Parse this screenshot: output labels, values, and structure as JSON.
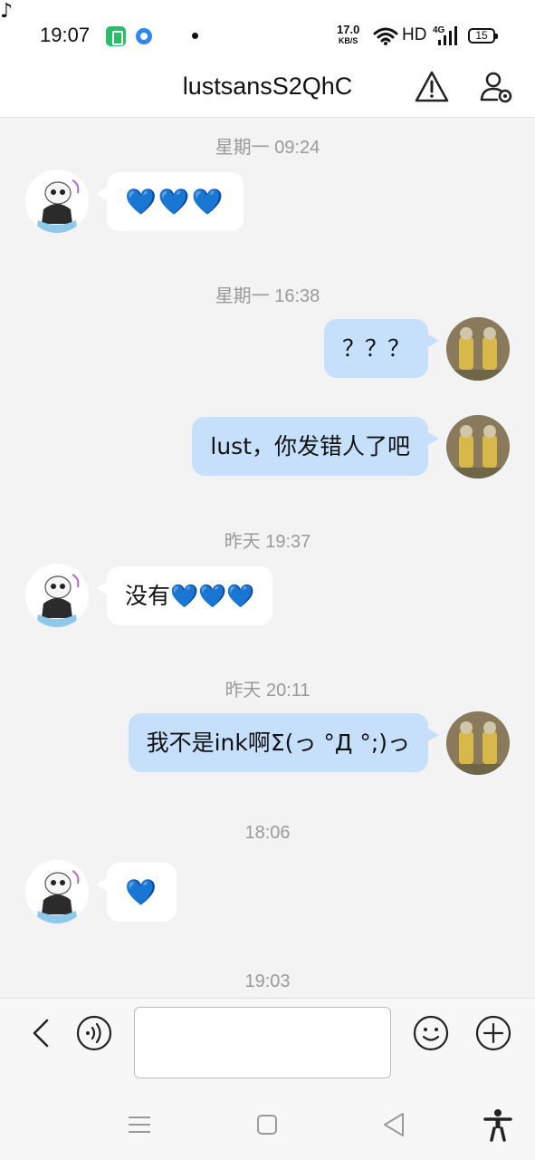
{
  "status_bar": {
    "time": "19:07",
    "net_speed": "17.0",
    "net_speed_unit": "KB/S",
    "hd": "HD",
    "network": "4G",
    "battery": "15",
    "icons": [
      "battery-saver-icon",
      "browser-icon",
      "tiktok-icon",
      "dot-icon",
      "wifi-icon",
      "signal-icon"
    ]
  },
  "header": {
    "title": "lustsansS2QhC",
    "icons": [
      "warning-icon",
      "user-settings-icon"
    ]
  },
  "messages": [
    {
      "timestamp": "星期一 09:24"
    },
    {
      "side": "left",
      "text": "💙💙💙"
    },
    {
      "timestamp": "星期一 16:38"
    },
    {
      "side": "right",
      "text": "？？？"
    },
    {
      "side": "right",
      "text": "lust，你发错人了吧"
    },
    {
      "timestamp": "昨天 19:37"
    },
    {
      "side": "left",
      "text": "没有💙💙💙"
    },
    {
      "timestamp": "昨天 20:11"
    },
    {
      "side": "right",
      "text": "我不是ink啊Σ(っ °Д °;)っ"
    },
    {
      "timestamp": "18:06"
    },
    {
      "side": "left",
      "text": "💙"
    },
    {
      "timestamp": "19:03"
    }
  ],
  "input_bar": {
    "value": "",
    "icons": [
      "back-icon",
      "voice-icon",
      "emoji-icon",
      "plus-icon"
    ]
  },
  "nav_bar": {
    "icons": [
      "menu-icon",
      "home-icon",
      "back-triangle-icon",
      "accessibility-icon"
    ]
  },
  "colors": {
    "background": "#f3f3f3",
    "bubble_left": "#ffffff",
    "bubble_right": "#c6e0fb",
    "heart": "#1a8cf0"
  }
}
